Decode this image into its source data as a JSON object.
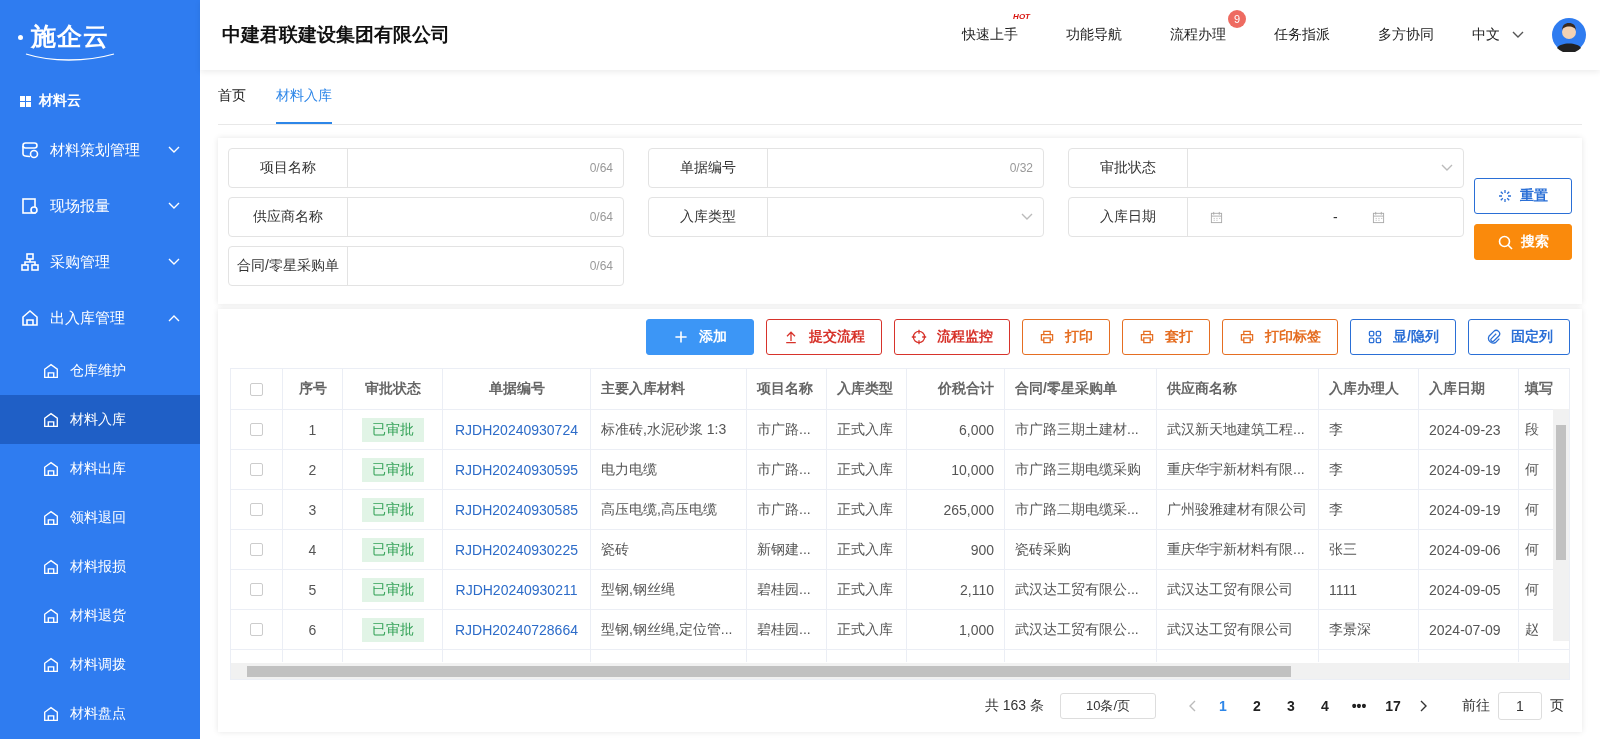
{
  "brand": {
    "name": "施企云"
  },
  "company": "中建君联建设集团有限公司",
  "top_nav": [
    {
      "label": "快速上手",
      "hot": "HOT"
    },
    {
      "label": "功能导航"
    },
    {
      "label": "流程办理",
      "count": "9"
    },
    {
      "label": "任务指派"
    },
    {
      "label": "多方协同"
    }
  ],
  "language": "中文",
  "sidebar": {
    "section": "材料云",
    "items": [
      {
        "label": "材料策划管理",
        "expanded": false
      },
      {
        "label": "现场报量",
        "expanded": false
      },
      {
        "label": "采购管理",
        "expanded": false
      },
      {
        "label": "出入库管理",
        "expanded": true,
        "children": [
          {
            "label": "仓库维护",
            "selected": false
          },
          {
            "label": "材料入库",
            "selected": true
          },
          {
            "label": "材料出库",
            "selected": false
          },
          {
            "label": "领料退回",
            "selected": false
          },
          {
            "label": "材料报损",
            "selected": false
          },
          {
            "label": "材料退货",
            "selected": false
          },
          {
            "label": "材料调拨",
            "selected": false
          },
          {
            "label": "材料盘点",
            "selected": false
          }
        ]
      }
    ]
  },
  "tabs": [
    {
      "label": "首页",
      "selected": false
    },
    {
      "label": "材料入库",
      "selected": true
    }
  ],
  "filters": [
    {
      "label": "项目名称",
      "kind": "text",
      "counter": "0/64"
    },
    {
      "label": "单据编号",
      "kind": "text",
      "counter": "0/32"
    },
    {
      "label": "审批状态",
      "kind": "select"
    },
    {
      "label": "供应商名称",
      "kind": "text",
      "counter": "0/64"
    },
    {
      "label": "入库类型",
      "kind": "select"
    },
    {
      "label": "入库日期",
      "kind": "daterange",
      "separator": "-"
    },
    {
      "label": "合同/零星采购单",
      "kind": "text",
      "counter": "0/64"
    }
  ],
  "filter_buttons": [
    {
      "label": "重置",
      "kind": "reset"
    },
    {
      "label": "搜索",
      "kind": "search"
    }
  ],
  "toolbar": [
    {
      "label": "添加",
      "kind": "primary"
    },
    {
      "label": "提交流程",
      "kind": "danger"
    },
    {
      "label": "流程监控",
      "kind": "danger"
    },
    {
      "label": "打印",
      "kind": "warning"
    },
    {
      "label": "套打",
      "kind": "warning"
    },
    {
      "label": "打印标签",
      "kind": "warning"
    },
    {
      "label": "显/隐列",
      "kind": "info"
    },
    {
      "label": "固定列",
      "kind": "info"
    }
  ],
  "table": {
    "all_checked": false,
    "columns": [
      "序号",
      "审批状态",
      "单据编号",
      "主要入库材料",
      "项目名称",
      "入库类型",
      "价税合计",
      "合同/零星采购单",
      "供应商名称",
      "入库办理人",
      "入库日期",
      "填写"
    ],
    "rows": [
      {
        "checked": false,
        "cells": [
          "1",
          "已审批",
          "RJDH20240930724",
          "标准砖,水泥砂浆 1:3",
          "市广路...",
          "正式入库",
          "6,000",
          "市广路三期土建材...",
          "武汉新天地建筑工程...",
          "李",
          "2024-09-23",
          "段"
        ]
      },
      {
        "checked": false,
        "cells": [
          "2",
          "已审批",
          "RJDH20240930595",
          "电力电缆",
          "市广路...",
          "正式入库",
          "10,000",
          "市广路三期电缆采购",
          "重庆华宇新材料有限...",
          "李",
          "2024-09-19",
          "何"
        ]
      },
      {
        "checked": false,
        "cells": [
          "3",
          "已审批",
          "RJDH20240930585",
          "高压电缆,高压电缆",
          "市广路...",
          "正式入库",
          "265,000",
          "市广路二期电缆采...",
          "广州骏雅建材有限公司",
          "李",
          "2024-09-19",
          "何"
        ]
      },
      {
        "checked": false,
        "cells": [
          "4",
          "已审批",
          "RJDH20240930225",
          "瓷砖",
          "新钢建...",
          "正式入库",
          "900",
          "瓷砖采购",
          "重庆华宇新材料有限...",
          "张三",
          "2024-09-06",
          "何"
        ]
      },
      {
        "checked": false,
        "cells": [
          "5",
          "已审批",
          "RJDH20240930211",
          "型钢,钢丝绳",
          "碧桂园...",
          "正式入库",
          "2,110",
          "武汉达工贸有限公...",
          "武汉达工贸有限公司",
          "1111",
          "2024-09-05",
          "何"
        ]
      },
      {
        "checked": false,
        "cells": [
          "6",
          "已审批",
          "RJDH20240728664",
          "型钢,钢丝绳,定位管...",
          "碧桂园...",
          "正式入库",
          "1,000",
          "武汉达工贸有限公...",
          "武汉达工贸有限公司",
          "李景深",
          "2024-07-09",
          "赵"
        ]
      }
    ]
  },
  "pagination": {
    "total": "共 163 条",
    "page_size": "10条/页",
    "pages": [
      {
        "label": "1",
        "selected": true
      },
      {
        "label": "2",
        "selected": false
      },
      {
        "label": "3",
        "selected": false
      },
      {
        "label": "4",
        "selected": false
      },
      {
        "label": "•••",
        "selected": false
      },
      {
        "label": "17",
        "selected": false
      }
    ],
    "goto_label": "前往",
    "goto_value": "1",
    "page_unit": "页"
  }
}
